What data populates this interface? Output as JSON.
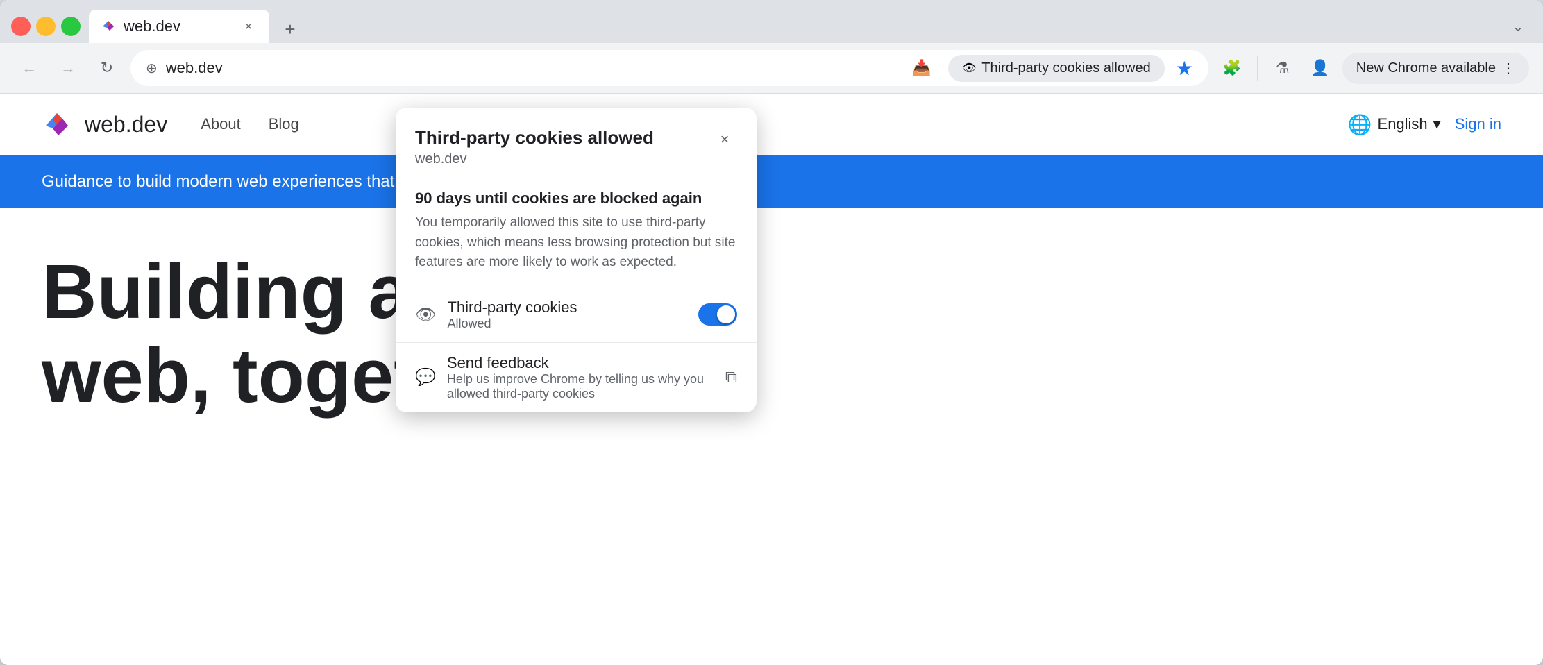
{
  "browser": {
    "tab": {
      "favicon": "▶",
      "title": "web.dev",
      "close_label": "×"
    },
    "new_tab_label": "+",
    "window_menu_label": "⌄"
  },
  "navbar": {
    "back_label": "←",
    "forward_label": "→",
    "reload_label": "↻",
    "address_icon": "⊕",
    "address_url": "web.dev",
    "cookies_badge_text": "Third-party cookies allowed",
    "star_label": "★",
    "extensions_label": "🧩",
    "lab_label": "⚗",
    "profile_label": "👤",
    "new_chrome_label": "New Chrome available",
    "more_label": "⋮"
  },
  "site": {
    "logo_text": "web.dev",
    "nav_items": [
      "About",
      "Blog"
    ],
    "lang_label": "English",
    "lang_icon": "🌐",
    "signin_label": "Sign in",
    "banner_text": "Guidance to build modern web experiences that work",
    "hero_line1": "Building a bet",
    "hero_line2": "web, togethe"
  },
  "popup": {
    "title": "Third-party cookies allowed",
    "subtitle": "web.dev",
    "close_label": "×",
    "warning_title": "90 days until cookies are blocked again",
    "warning_text": "You temporarily allowed this site to use third-party cookies, which means less browsing protection but site features are more likely to work as expected.",
    "cookies_section": {
      "icon": "👁",
      "label": "Third-party cookies",
      "sublabel": "Allowed",
      "toggle_on": true
    },
    "feedback_section": {
      "icon": "💬",
      "label": "Send feedback",
      "sublabel": "Help us improve Chrome by telling us why you allowed third-party cookies",
      "ext_link": "⧉"
    }
  },
  "colors": {
    "accent_blue": "#1a73e8",
    "toggle_bg": "#1a73e8"
  }
}
